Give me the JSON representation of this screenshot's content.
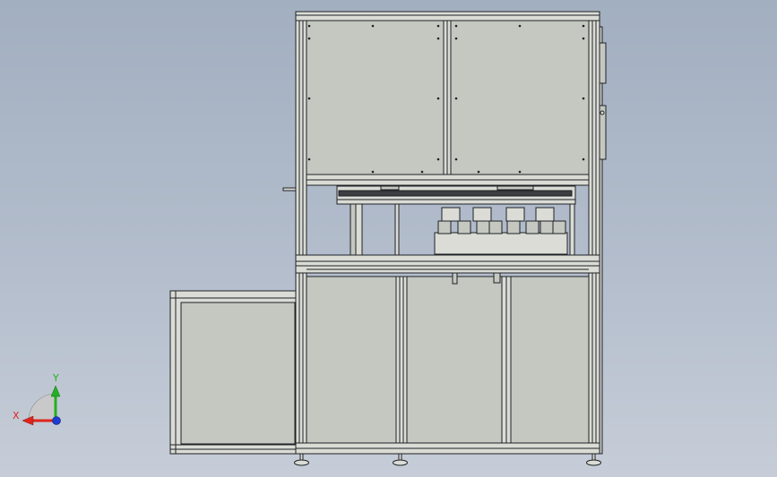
{
  "viewport": {
    "background_top": "#a2afc0",
    "background_bottom": "#c6cdd8"
  },
  "model": {
    "panel_fill": "#c5c8c0",
    "frame_fill": "#dadcd5",
    "edge_color": "#1f2226"
  },
  "triad": {
    "x_label": "X",
    "y_label": "Y",
    "x_color": "#e0241b",
    "y_color": "#22b022",
    "z_color": "#1f3cd0"
  }
}
